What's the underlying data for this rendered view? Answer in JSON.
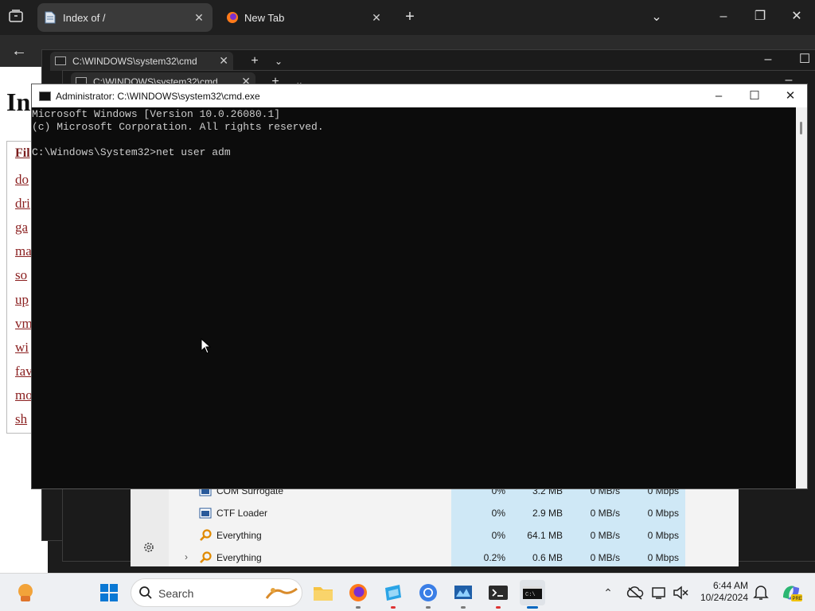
{
  "browser": {
    "tabs": [
      {
        "label": "Index of /",
        "active": true
      },
      {
        "label": "New Tab",
        "active": false
      }
    ],
    "new_tab": "+",
    "page": {
      "title": "In",
      "table_header": "Fil",
      "links": [
        "do",
        "dri",
        "ga",
        "ma",
        "so",
        "up",
        "vm",
        "wi",
        "fav",
        "mo",
        "sh"
      ]
    }
  },
  "background_windows": [
    {
      "tab_label": "C:\\WINDOWS\\system32\\cmd"
    },
    {
      "tab_label": "C:\\WINDOWS\\system32\\cmd"
    }
  ],
  "cmd": {
    "title": "Administrator: C:\\WINDOWS\\system32\\cmd.exe",
    "lines": [
      "Microsoft Windows [Version 10.0.26080.1]",
      "(c) Microsoft Corporation. All rights reserved.",
      "",
      "C:\\Windows\\System32>net user adm"
    ]
  },
  "task_manager": {
    "rows": [
      {
        "name": "COM Surrogate",
        "cpu": "0%",
        "memory": "3.2 MB",
        "disk": "0 MB/s",
        "network": "0 Mbps",
        "icon": "app-frame-icon"
      },
      {
        "name": "CTF Loader",
        "cpu": "0%",
        "memory": "2.9 MB",
        "disk": "0 MB/s",
        "network": "0 Mbps",
        "icon": "app-frame-icon"
      },
      {
        "name": "Everything",
        "cpu": "0%",
        "memory": "64.1 MB",
        "disk": "0 MB/s",
        "network": "0 Mbps",
        "icon": "magnifier-icon"
      },
      {
        "name": "Everything",
        "cpu": "0.2%",
        "memory": "0.6 MB",
        "disk": "0 MB/s",
        "network": "0 Mbps",
        "icon": "magnifier-icon"
      }
    ]
  },
  "taskbar": {
    "search_label": "Search",
    "time": "6:44 AM",
    "date": "10/24/2024",
    "accent": "#0067c0"
  }
}
